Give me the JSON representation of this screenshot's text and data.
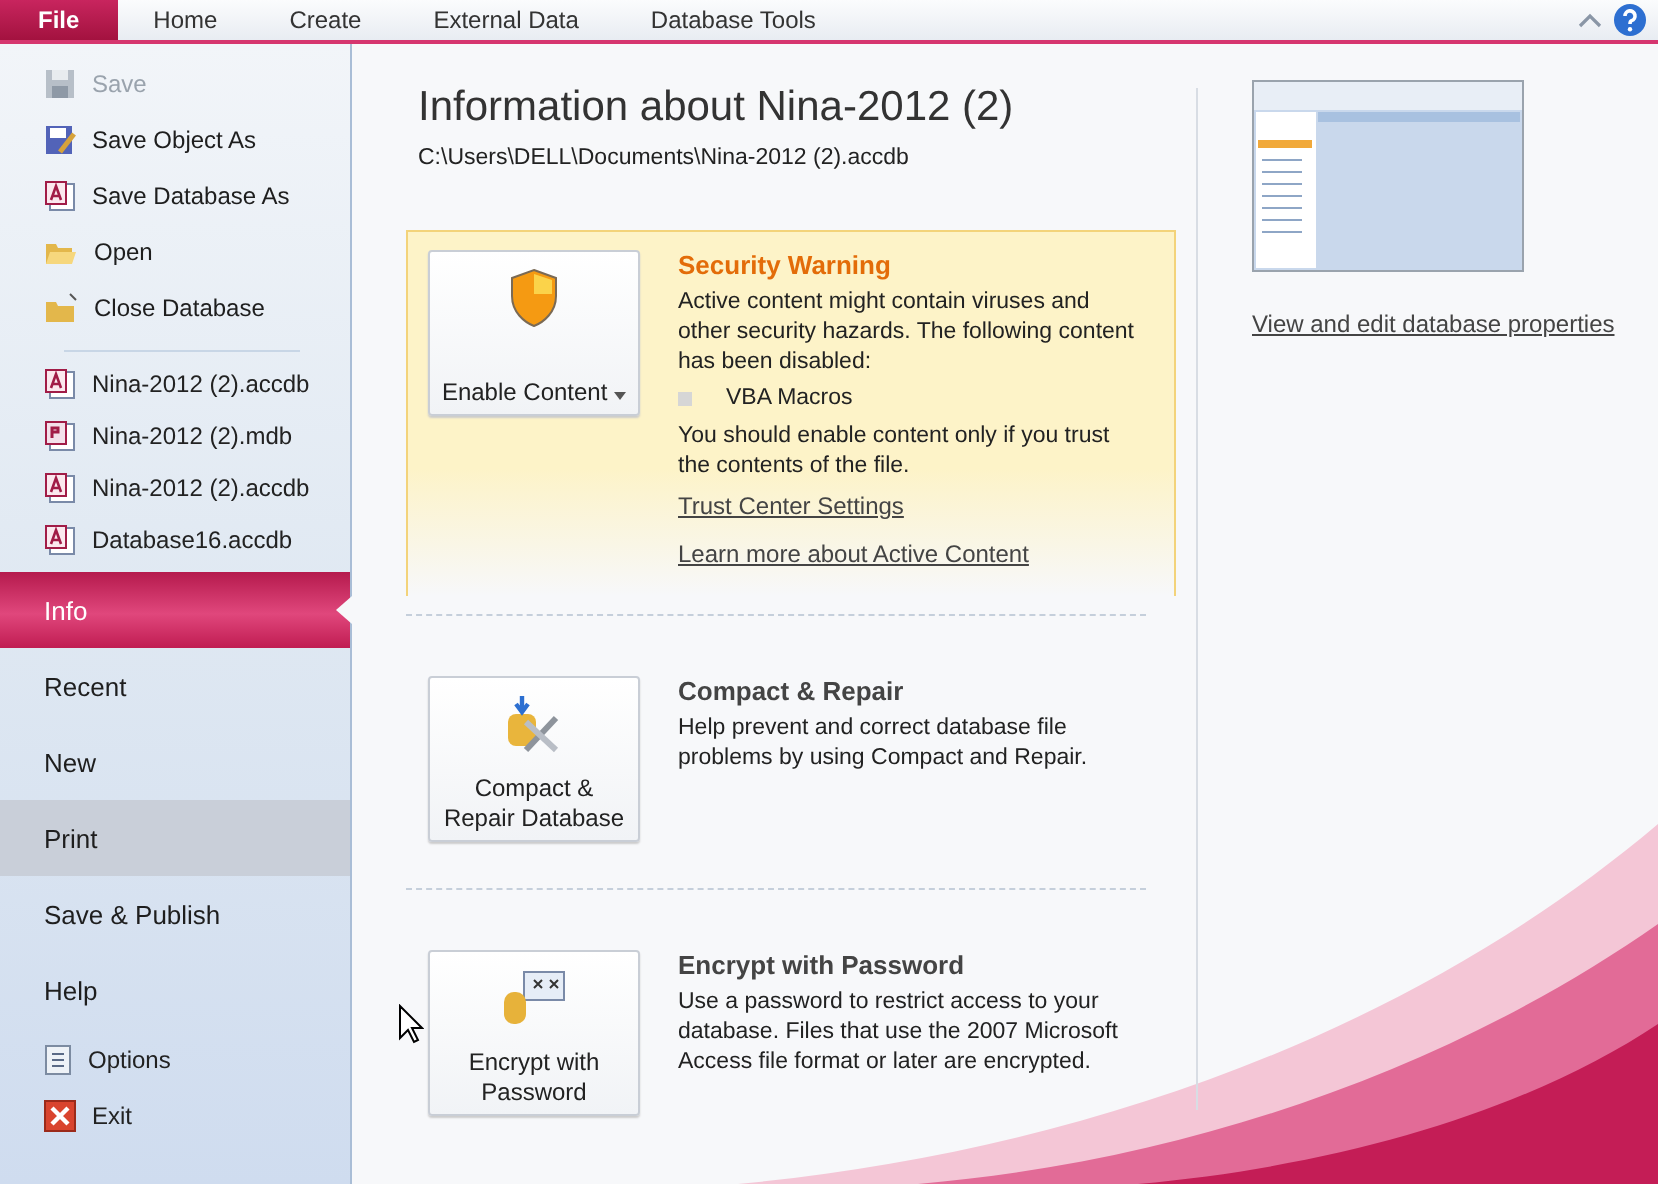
{
  "ribbon": {
    "tabs": [
      {
        "label": "File",
        "selected": true
      },
      {
        "label": "Home",
        "selected": false
      },
      {
        "label": "Create",
        "selected": false
      },
      {
        "label": "External Data",
        "selected": false
      },
      {
        "label": "Database Tools",
        "selected": false
      }
    ]
  },
  "backstage": {
    "commands": [
      {
        "label": "Save",
        "kind": "save",
        "disabled": true
      },
      {
        "label": "Save Object As",
        "kind": "save-as",
        "disabled": false
      },
      {
        "label": "Save Database As",
        "kind": "database",
        "disabled": false
      },
      {
        "label": "Open",
        "kind": "open",
        "disabled": false
      },
      {
        "label": "Close Database",
        "kind": "close",
        "disabled": false
      }
    ],
    "recent_files": [
      {
        "name": "Nina-2012 (2).accdb",
        "kind": "accdb"
      },
      {
        "name": "Nina-2012 (2).mdb",
        "kind": "mdb"
      },
      {
        "name": "Nina-2012 (2).accdb",
        "kind": "accdb"
      },
      {
        "name": "Database16.accdb",
        "kind": "accdb"
      }
    ],
    "views": [
      {
        "label": "Info",
        "selected": true,
        "hovered": false
      },
      {
        "label": "Recent",
        "selected": false,
        "hovered": false
      },
      {
        "label": "New",
        "selected": false,
        "hovered": false
      },
      {
        "label": "Print",
        "selected": false,
        "hovered": true
      },
      {
        "label": "Save & Publish",
        "selected": false,
        "hovered": false
      },
      {
        "label": "Help",
        "selected": false,
        "hovered": false
      }
    ],
    "footer": [
      {
        "label": "Options",
        "kind": "options"
      },
      {
        "label": "Exit",
        "kind": "exit"
      }
    ]
  },
  "info": {
    "title": "Information about Nina-2012 (2)",
    "path": "C:\\Users\\DELL\\Documents\\Nina-2012 (2).accdb",
    "sections": [
      {
        "kind": "security",
        "button": "Enable Content",
        "dropdown": true,
        "heading": "Security Warning",
        "text": "Active content might contain viruses and other security hazards. The following content has been disabled:",
        "bullets": [
          "VBA Macros"
        ],
        "note": "You should enable content only if you trust the contents of the file.",
        "links": [
          "Trust Center Settings",
          "Learn more about Active Content"
        ]
      },
      {
        "kind": "compact",
        "button": "Compact & Repair Database",
        "dropdown": false,
        "heading": "Compact & Repair",
        "text": "Help prevent and correct database file problems by using Compact and Repair."
      },
      {
        "kind": "encrypt",
        "button": "Encrypt with Password",
        "dropdown": false,
        "heading": "Encrypt with Password",
        "text": "Use a password to restrict access to your database. Files that use the 2007 Microsoft Access file format or later are encrypted."
      }
    ],
    "properties_link": "View and edit database properties"
  }
}
